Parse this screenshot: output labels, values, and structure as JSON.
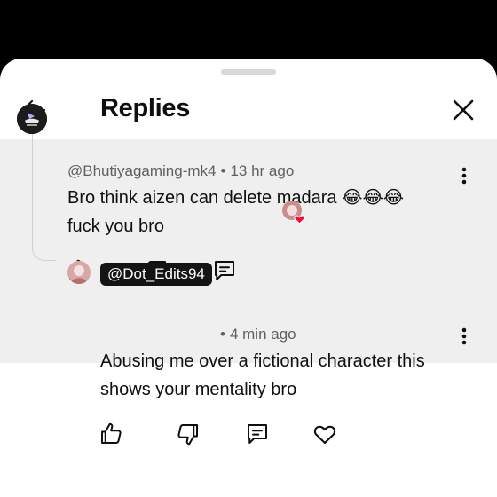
{
  "header": {
    "title": "Replies"
  },
  "parent_comment": {
    "author": "@Bhutiyagaming-mk4",
    "time": "13 hr ago",
    "text_line1": "Bro think aizen can delete madara 😂😂😂",
    "text_line2": "fuck you bro",
    "separator": "•"
  },
  "reply": {
    "author": "@Dot_Edits94",
    "time": "4 min ago",
    "text_line1": "Abusing me over a fictional character this",
    "text_line2": "shows your mentality bro",
    "separator": "•"
  },
  "colors": {
    "sheet_bg": "#ffffff",
    "parent_bg": "#efefef",
    "meta_text": "#606060",
    "badge_bg": "#141414",
    "heart_red": "#ff0033"
  },
  "icons": [
    "back-arrow-icon",
    "close-icon",
    "more-vert-icon",
    "like-icon",
    "dislike-icon",
    "reply-icon",
    "creator-heart-icon",
    "heart-icon"
  ]
}
